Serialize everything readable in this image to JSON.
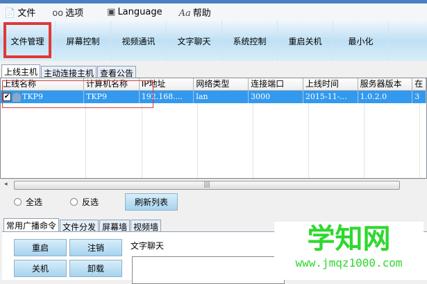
{
  "menu": {
    "file": "文件",
    "options": "选项",
    "language": "Language",
    "help": "帮助"
  },
  "toolbar": [
    "文件管理",
    "屏幕控制",
    "视频通讯",
    "文字聊天",
    "系统控制",
    "重启关机",
    "最小化"
  ],
  "tabs": [
    "上线主机",
    "主动连接主机",
    "查看公告"
  ],
  "table": {
    "headers": [
      "上线名称",
      "计算机名称",
      "IP地址",
      "网络类型",
      "连接端口",
      "上线时间",
      "服务器版本",
      "在"
    ],
    "rows": [
      [
        "TKP9",
        "TKP9",
        "192.168....",
        "lan",
        "3000",
        "2015-11-...",
        "1.0.2.0",
        "3"
      ]
    ]
  },
  "controls": {
    "select_all": "全选",
    "invert": "反选",
    "refresh": "刷新列表"
  },
  "bottom_tabs": [
    "常用广播命令",
    "文件分发",
    "屏幕墙",
    "视频墙"
  ],
  "commands": [
    "重启",
    "注销",
    "关机",
    "卸载"
  ],
  "chat_label": "文字聊天",
  "watermark": {
    "title": "学知网",
    "url": "www.jmqz1000.com"
  }
}
